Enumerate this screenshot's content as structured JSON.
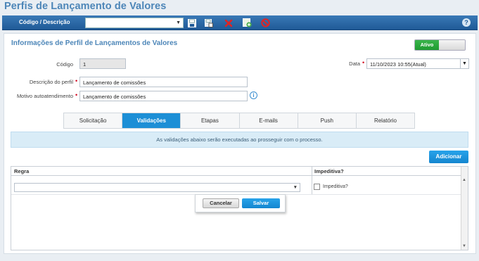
{
  "page": {
    "title": "Perfis de Lançamento de Valores"
  },
  "toolbar": {
    "filter_label": "Código / Descrição",
    "filter_value": "",
    "icons": [
      "save-icon",
      "save-copy-icon",
      "delete-icon",
      "add-icon",
      "cancel-icon",
      "help-icon"
    ],
    "help_glyph": "?"
  },
  "section": {
    "title": "Informações de Perfil de Lançamentos de Valores"
  },
  "status_toggle": {
    "label": "Ativo",
    "on": true,
    "color": "#2aa83c"
  },
  "form": {
    "codigo_label": "Código",
    "codigo_value": "1",
    "descricao_label": "Descrição do perfil",
    "descricao_value": "Lançamento de comissões",
    "motivo_label": "Motivo autoatendimento",
    "motivo_value": "Lançamento de comissões",
    "data_label": "Data",
    "data_value": "11/10/2023 10:55(Atual)",
    "required_mark": "•",
    "info_glyph": "i"
  },
  "tabs": [
    {
      "label": "Solicitação",
      "active": false
    },
    {
      "label": "Validações",
      "active": true
    },
    {
      "label": "Etapas",
      "active": false
    },
    {
      "label": "E-mails",
      "active": false
    },
    {
      "label": "Push",
      "active": false
    },
    {
      "label": "Relatório",
      "active": false
    }
  ],
  "notice": {
    "text": "As validações abaixo serão executadas ao prosseguir com o processo."
  },
  "add_button": {
    "label": "Adicionar"
  },
  "grid": {
    "columns": [
      "Regra",
      "Impeditiva?"
    ],
    "row": {
      "rule_value": "",
      "checkbox_label": "Impeditiva?",
      "checked": false
    }
  },
  "popup": {
    "cancel_label": "Cancelar",
    "save_label": "Salvar"
  },
  "colors": {
    "accent": "#1d8fd6",
    "title": "#4d86b8",
    "toolbar": "#2a68a6",
    "required": "#d0021b"
  }
}
